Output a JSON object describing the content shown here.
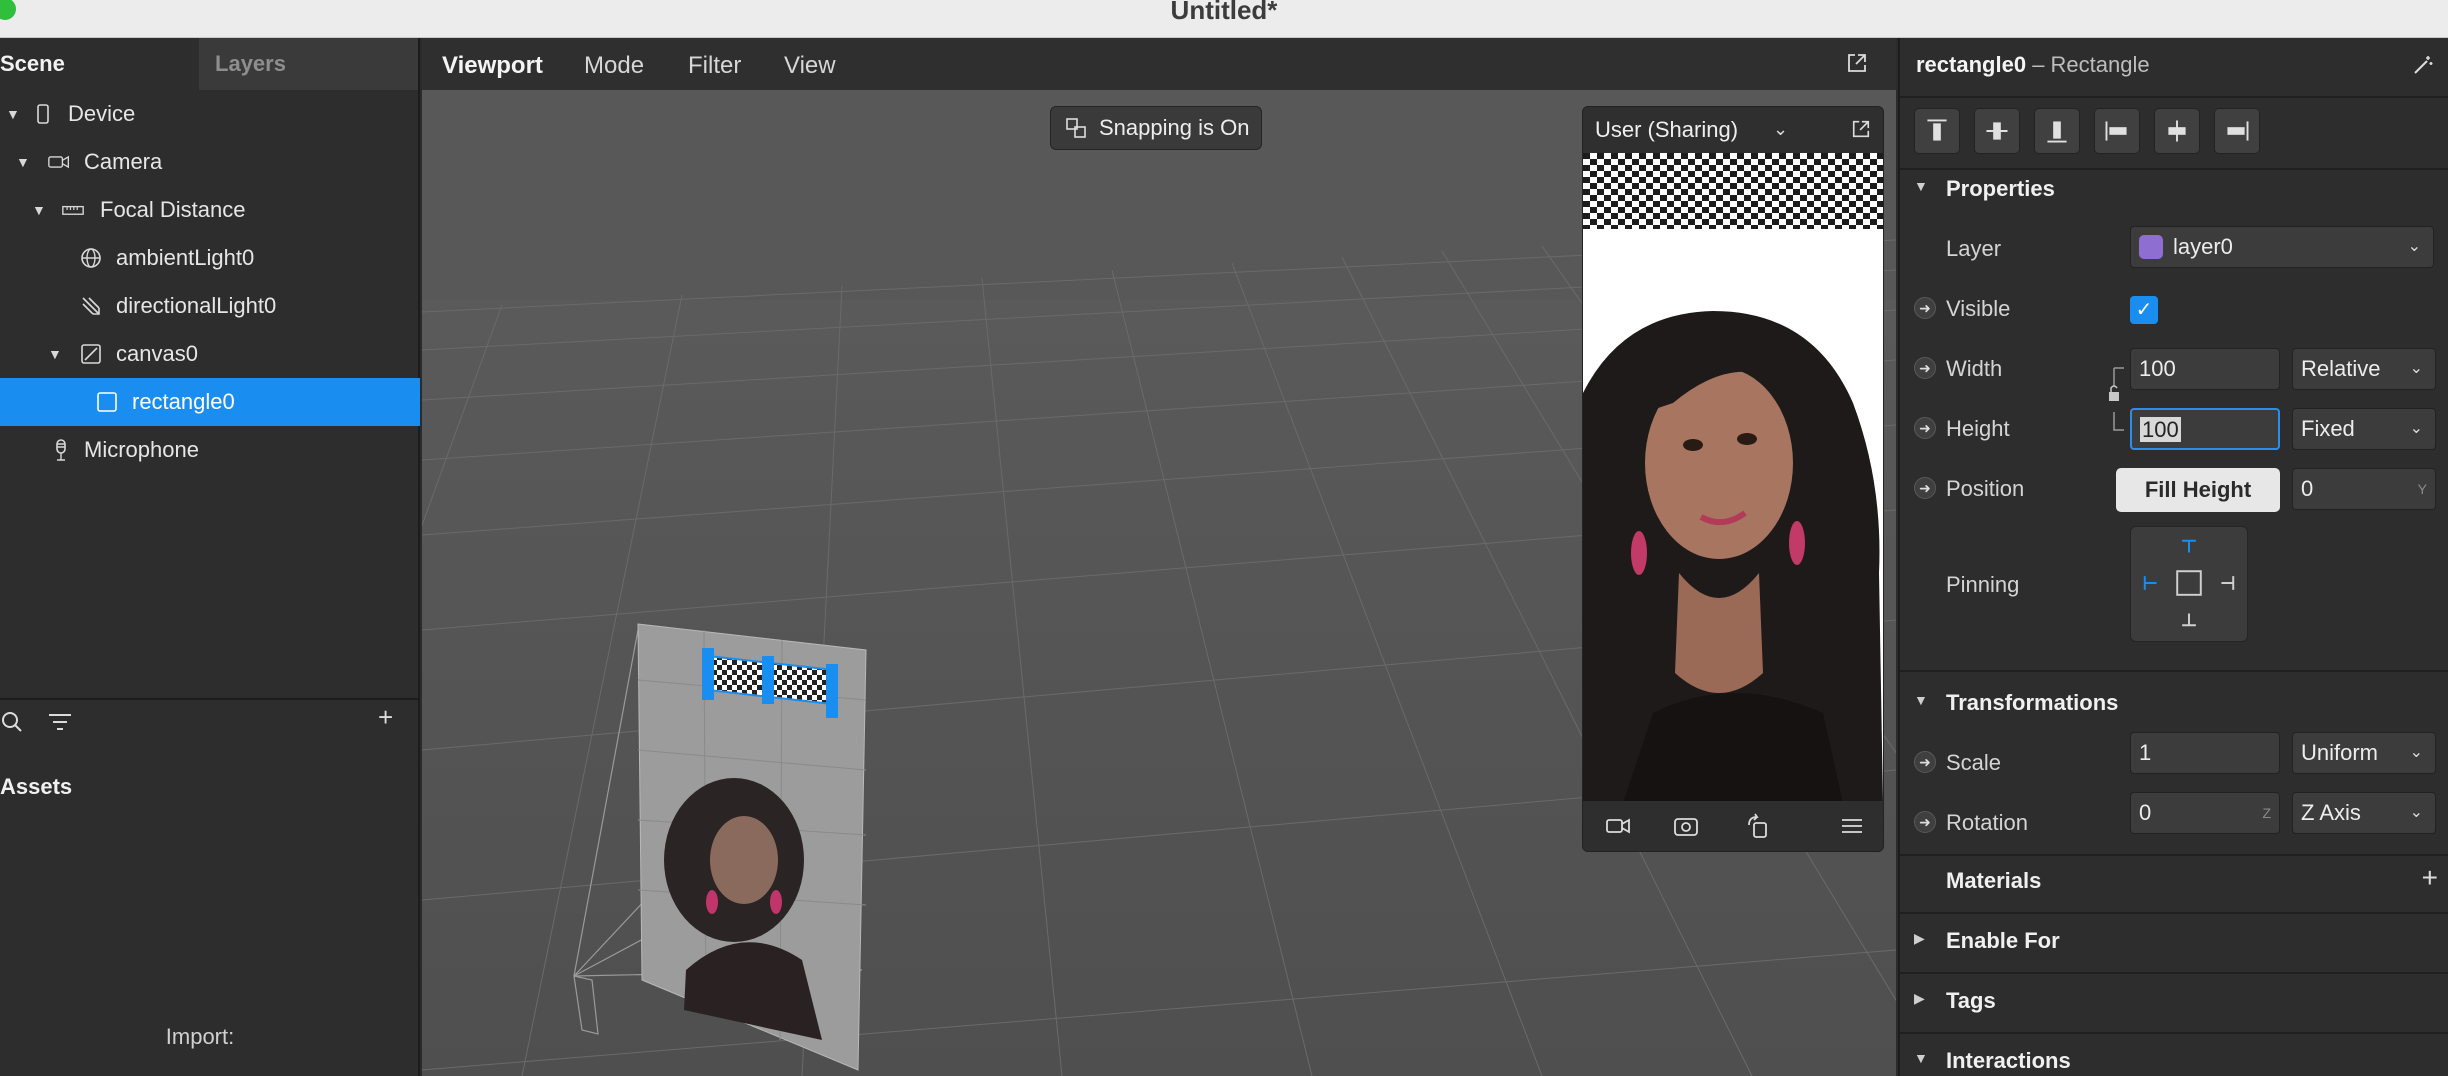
{
  "window": {
    "title": "Untitled*"
  },
  "left_panel": {
    "tabs": [
      "Scene",
      "Layers"
    ],
    "tree": [
      {
        "label": "Device",
        "icon": "phone-icon"
      },
      {
        "label": "Camera",
        "icon": "camera-icon"
      },
      {
        "label": "Focal Distance",
        "icon": "ruler-icon"
      },
      {
        "label": "ambientLight0",
        "icon": "globe-icon"
      },
      {
        "label": "directionalLight0",
        "icon": "directional-light-icon"
      },
      {
        "label": "canvas0",
        "icon": "canvas-icon"
      },
      {
        "label": "rectangle0",
        "icon": "rectangle-icon"
      },
      {
        "label": "Microphone",
        "icon": "microphone-icon"
      }
    ],
    "assets_title": "Assets",
    "import_label": "Import:"
  },
  "viewport": {
    "menu": [
      "Viewport",
      "Mode",
      "Filter",
      "View"
    ],
    "snapping_label": "Snapping is On",
    "preview": {
      "title": "User (Sharing)"
    }
  },
  "inspector": {
    "object_name": "rectangle0",
    "object_type": "– Rectangle",
    "sections": {
      "properties": "Properties",
      "transformations": "Transformations",
      "materials": "Materials",
      "enable_for": "Enable For",
      "tags": "Tags",
      "interactions": "Interactions"
    },
    "labels": {
      "layer": "Layer",
      "visible": "Visible",
      "width": "Width",
      "height": "Height",
      "position": "Position",
      "pinning": "Pinning",
      "scale": "Scale",
      "rotation": "Rotation"
    },
    "values": {
      "layer": "layer0",
      "visible_check": "✓",
      "width": "100",
      "width_mode": "Relative",
      "height": "100",
      "height_mode": "Fixed",
      "position_y": "0",
      "position_y_axis": "Y",
      "scale": "1",
      "scale_mode": "Uniform",
      "rotation": "0",
      "rotation_axis_hint": "Z",
      "rotation_axis": "Z Axis"
    },
    "tooltip": "Fill Height",
    "colors": {
      "layer_swatch": "#8e6fd1",
      "accent": "#1a8df0"
    }
  }
}
